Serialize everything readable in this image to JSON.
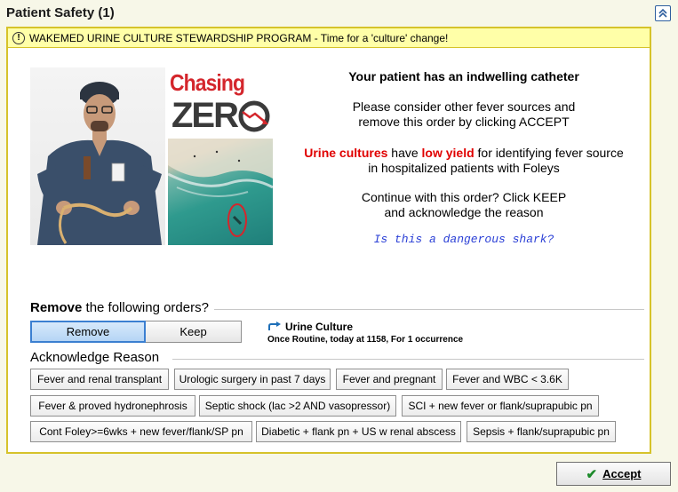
{
  "header": {
    "title": "Patient Safety (1)",
    "collapse_icon": "double-chevron-up-icon"
  },
  "alert": {
    "icon": "exclamation-circle-icon",
    "text": "WAKEMED URINE CULTURE STEWARDSHIP PROGRAM - Time for a 'culture' change!"
  },
  "branding": {
    "chasing": "Chasing",
    "zero": "ZER"
  },
  "message": {
    "title": "Your patient has an indwelling catheter",
    "line1a": "Please consider other fever sources and",
    "line1b": "remove this order by clicking ACCEPT",
    "line2_red1": "Urine cultures",
    "line2_mid": " have ",
    "line2_red2": "low yield",
    "line2_rest": " for identifying fever source",
    "line2b": "in hospitalized patients with Foleys",
    "line3a": "Continue with this order?  Click KEEP",
    "line3b": "and acknowledge the reason",
    "shark": "Is this a dangerous shark?"
  },
  "remove_section": {
    "label_bold": "Remove",
    "label_rest": " the following orders?",
    "options": [
      "Remove",
      "Keep"
    ],
    "selected": "Remove"
  },
  "order": {
    "name": "Urine Culture",
    "detail": "Once Routine, today at 1158, For 1 occurrence"
  },
  "acknowledge": {
    "label": "Acknowledge Reason",
    "reasons": [
      "Fever and renal transplant",
      "Urologic surgery in past 7 days",
      "Fever and pregnant",
      "Fever and WBC < 3.6K",
      "Fever & proved hydronephrosis",
      "Septic shock (lac >2 AND vasopressor)",
      "SCI + new fever or flank/suprapubic pn",
      "Cont Foley>=6wks + new fever/flank/SP pn",
      "Diabetic + flank pn + US w renal abscess",
      "Sepsis + flank/suprapubic pn"
    ]
  },
  "footer": {
    "accept_label": "Accept"
  },
  "colors": {
    "alert_bg": "#ffffa8",
    "alert_border": "#d6c32a",
    "red_emphasis": "#e00000",
    "link_blue": "#2a3fd6",
    "selected_toggle": "#b5d5f5"
  }
}
